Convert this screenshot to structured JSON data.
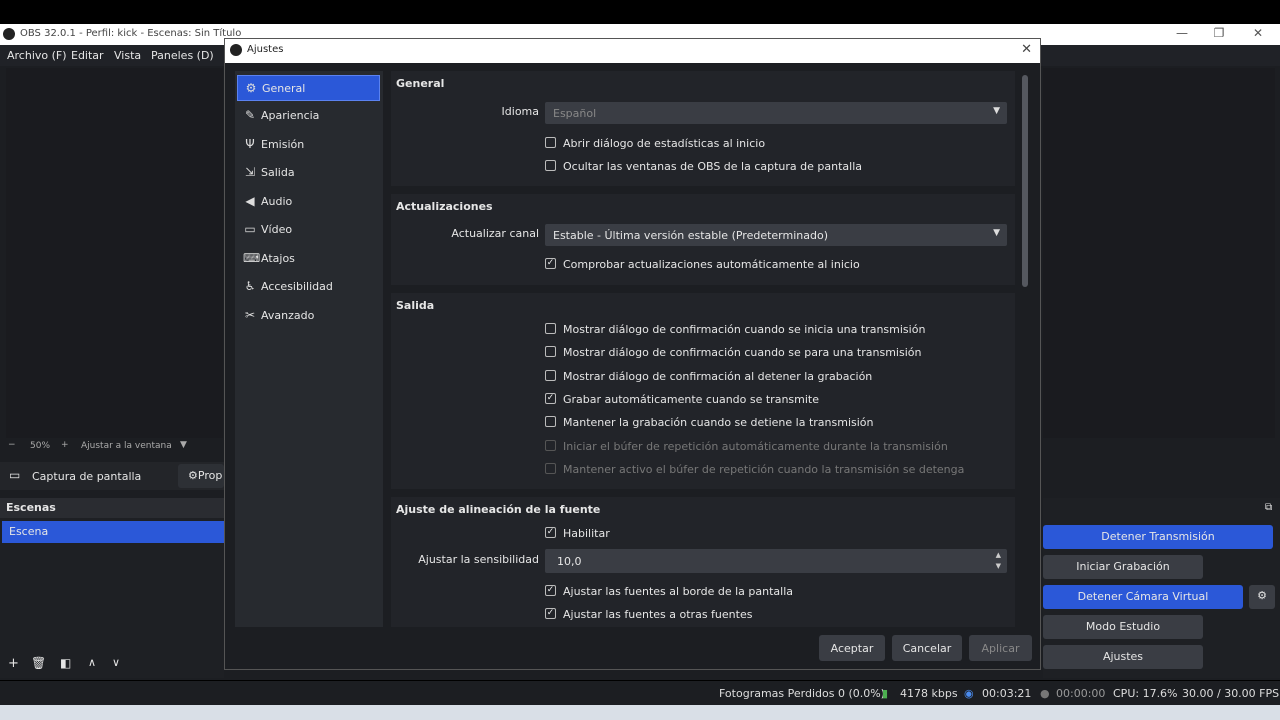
{
  "window": {
    "title": "OBS 32.0.1 - Perfil: kick - Escenas: Sin Título",
    "menu": [
      "Archivo (F)",
      "Editar",
      "Vista",
      "Paneles (D)"
    ]
  },
  "preview": {
    "zoom": "50%",
    "zoom_minus": "−",
    "zoom_plus": "+",
    "fit": "Ajustar a la ventana"
  },
  "source_bar": {
    "label": "Captura de pantalla",
    "props": "Prop"
  },
  "scenes": {
    "header": "Escenas",
    "items": [
      "Escena"
    ]
  },
  "controls": {
    "stop_stream": "Detener Transmisión",
    "start_record": "Iniciar Grabación",
    "stop_vcam": "Detener Cámara Virtual",
    "studio": "Modo Estudio",
    "settings": "Ajustes"
  },
  "status": {
    "dropped": "Fotogramas Perdidos 0 (0.0%)",
    "kbps": "4178 kbps",
    "stream_time": "00:03:21",
    "rec_time": "00:00:00",
    "cpu": "CPU: 17.6%",
    "fps": "30.00 / 30.00 FPS"
  },
  "dialog": {
    "title": "Ajustes",
    "nav": [
      {
        "label": "General",
        "icon": "gear-icon",
        "glyph": "⚙"
      },
      {
        "label": "Apariencia",
        "icon": "appearance-icon",
        "glyph": "✎"
      },
      {
        "label": "Emisión",
        "icon": "antenna-icon",
        "glyph": "📶"
      },
      {
        "label": "Salida",
        "icon": "output-icon",
        "glyph": "⇲"
      },
      {
        "label": "Audio",
        "icon": "speaker-icon",
        "glyph": "🔈"
      },
      {
        "label": "Vídeo",
        "icon": "monitor-icon",
        "glyph": "▭"
      },
      {
        "label": "Atajos",
        "icon": "keyboard-icon",
        "glyph": "⌨"
      },
      {
        "label": "Accesibilidad",
        "icon": "accessibility-icon",
        "glyph": "♿"
      },
      {
        "label": "Avanzado",
        "icon": "tools-icon",
        "glyph": "✂"
      }
    ],
    "general": {
      "header": "General",
      "lang_label": "Idioma",
      "lang_value": "Español",
      "checks": [
        {
          "label": "Abrir diálogo de estadísticas al inicio",
          "checked": false
        },
        {
          "label": "Ocultar las ventanas de OBS de la captura de pantalla",
          "checked": false
        }
      ]
    },
    "updates": {
      "header": "Actualizaciones",
      "channel_label": "Actualizar canal",
      "channel_value": "Estable - Última versión estable (Predeterminado)",
      "check": {
        "label": "Comprobar actualizaciones automáticamente al inicio",
        "checked": true
      }
    },
    "output": {
      "header": "Salida",
      "checks": [
        {
          "label": "Mostrar diálogo de confirmación cuando se inicia una transmisión",
          "checked": false,
          "disabled": false
        },
        {
          "label": "Mostrar diálogo de confirmación cuando se para una transmisión",
          "checked": false,
          "disabled": false
        },
        {
          "label": "Mostrar diálogo de confirmación al detener la grabación",
          "checked": false,
          "disabled": false
        },
        {
          "label": "Grabar automáticamente cuando se transmite",
          "checked": true,
          "disabled": false
        },
        {
          "label": "Mantener la grabación cuando se detiene la transmisión",
          "checked": false,
          "disabled": false
        },
        {
          "label": "Iniciar el búfer de repetición automáticamente durante la transmisión",
          "checked": false,
          "disabled": true
        },
        {
          "label": "Mantener activo el búfer de repetición cuando la transmisión se detenga",
          "checked": false,
          "disabled": true
        }
      ]
    },
    "snap": {
      "header": "Ajuste de alineación de la fuente",
      "enable": {
        "label": "Habilitar",
        "checked": true
      },
      "sens_label": "Ajustar la sensibilidad",
      "sens_value": "10,0",
      "checks": [
        {
          "label": "Ajustar las fuentes al borde de la pantalla",
          "checked": true
        },
        {
          "label": "Ajustar las fuentes a otras fuentes",
          "checked": true
        }
      ]
    },
    "buttons": {
      "ok": "Aceptar",
      "cancel": "Cancelar",
      "apply": "Aplicar"
    }
  },
  "colors": {
    "accent": "#2b58d8",
    "bg": "#1c1e22",
    "panel": "#222429"
  }
}
